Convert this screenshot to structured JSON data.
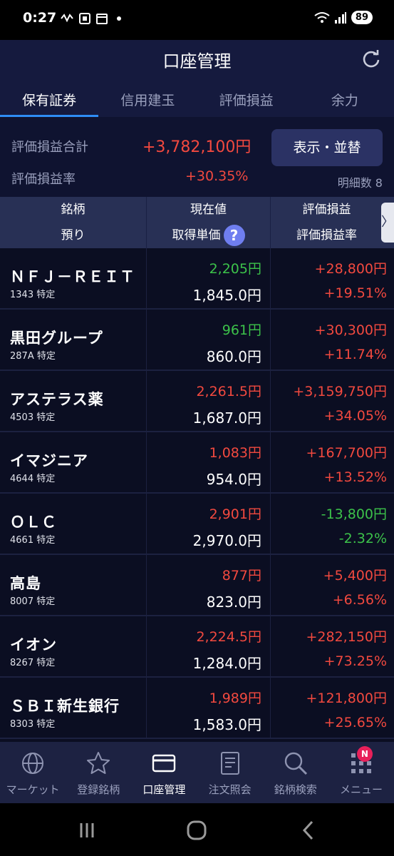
{
  "status": {
    "time": "0:27",
    "battery": "89"
  },
  "header": {
    "title": "口座管理"
  },
  "tabs": [
    {
      "label": "保有証券",
      "active": true
    },
    {
      "label": "信用建玉",
      "active": false
    },
    {
      "label": "評価損益",
      "active": false
    },
    {
      "label": "余力",
      "active": false
    }
  ],
  "summary": {
    "total_label": "評価損益合計",
    "total_value": "+3,782,100円",
    "rate_label": "評価損益率",
    "rate_value": "+30.35%",
    "sort_button": "表示・並替",
    "detail_count": "明細数 8"
  },
  "table_header": {
    "col1_top": "銘柄",
    "col1_bottom": "預り",
    "col2_top": "現在値",
    "col2_bottom": "取得単価",
    "col3_top": "評価損益",
    "col3_bottom": "評価損益率",
    "help": "?",
    "scroll": "〉"
  },
  "rows": [
    {
      "name": "ＮＦＪ－ＲＥＩＴ",
      "code": "1343 特定",
      "price": "2,205円",
      "price_color": "green",
      "cost": "1,845.0円",
      "pl": "+28,800円",
      "pl_rate": "+19.51%",
      "pl_color": "red"
    },
    {
      "name": "黒田グループ",
      "code": "287A 特定",
      "price": "961円",
      "price_color": "green",
      "cost": "860.0円",
      "pl": "+30,300円",
      "pl_rate": "+11.74%",
      "pl_color": "red"
    },
    {
      "name": "アステラス薬",
      "code": "4503 特定",
      "price": "2,261.5円",
      "price_color": "red",
      "cost": "1,687.0円",
      "pl": "+3,159,750円",
      "pl_rate": "+34.05%",
      "pl_color": "red"
    },
    {
      "name": "イマジニア",
      "code": "4644 特定",
      "price": "1,083円",
      "price_color": "red",
      "cost": "954.0円",
      "pl": "+167,700円",
      "pl_rate": "+13.52%",
      "pl_color": "red"
    },
    {
      "name": "ＯＬＣ",
      "code": "4661 特定",
      "price": "2,901円",
      "price_color": "red",
      "cost": "2,970.0円",
      "pl": "-13,800円",
      "pl_rate": "-2.32%",
      "pl_color": "green"
    },
    {
      "name": "高島",
      "code": "8007 特定",
      "price": "877円",
      "price_color": "red",
      "cost": "823.0円",
      "pl": "+5,400円",
      "pl_rate": "+6.56%",
      "pl_color": "red"
    },
    {
      "name": "イオン",
      "code": "8267 特定",
      "price": "2,224.5円",
      "price_color": "red",
      "cost": "1,284.0円",
      "pl": "+282,150円",
      "pl_rate": "+73.25%",
      "pl_color": "red"
    },
    {
      "name": "ＳＢＩ新生銀行",
      "code": "8303 特定",
      "price": "1,989円",
      "price_color": "red",
      "cost": "1,583.0円",
      "pl": "+121,800円",
      "pl_rate": "+25.65%",
      "pl_color": "red"
    }
  ],
  "bottom_nav": [
    {
      "label": "マーケット",
      "icon": "globe-icon",
      "active": false
    },
    {
      "label": "登録銘柄",
      "icon": "star-icon",
      "active": false
    },
    {
      "label": "口座管理",
      "icon": "card-icon",
      "active": true
    },
    {
      "label": "注文照会",
      "icon": "document-icon",
      "active": false
    },
    {
      "label": "銘柄検索",
      "icon": "search-icon",
      "active": false
    },
    {
      "label": "メニュー",
      "icon": "grid-menu-icon",
      "active": false,
      "badge": "N"
    }
  ],
  "colors": {
    "positive": "#f2493f",
    "negative": "#3cc24a",
    "accent": "#2f8df5",
    "background": "#0b0e22"
  }
}
